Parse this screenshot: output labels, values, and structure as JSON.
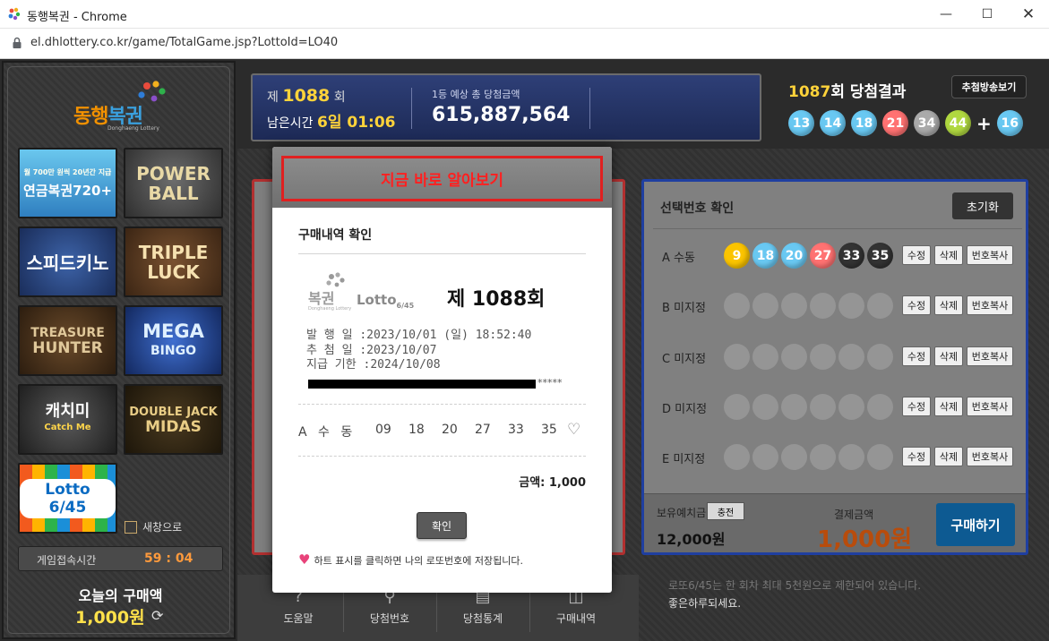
{
  "window": {
    "title": "동행복권 - Chrome",
    "url": "el.dhlottery.co.kr/game/TotalGame.jsp?LottoId=LO40"
  },
  "sidebar": {
    "logo_text_a": "동행",
    "logo_text_b": "복권",
    "logo_sub": "Donghaeng Lottery",
    "games": {
      "pension_badge": "월 700만 원씩 20년간 지급",
      "pension": "연금복권720+",
      "power_1": "POWER",
      "power_2": "BALL",
      "speed": "스피드키노",
      "triple_1": "TRIPLE",
      "triple_2": "LUCK",
      "treasure_1": "TREASURE",
      "treasure_2": "HUNTER",
      "mega_1": "MEGA",
      "mega_2": "BINGO",
      "catch_1": "캐치미",
      "catch_2": "Catch Me",
      "double_1": "DOUBLE JACK",
      "double_2": "MIDAS",
      "lotto": "Lotto 6/45"
    },
    "new_window_label": "새창으로",
    "access_time_label": "게임접속시간",
    "access_time_value": "59 : 04",
    "today_label": "오늘의 구매액",
    "today_amount": "1,000원"
  },
  "top": {
    "round_prefix": "제",
    "round_num": "1088",
    "round_suffix": "회",
    "remain_label": "남은시간",
    "remain_value": "6일 01:06",
    "jackpot_label": "1등 예상 총 당첨금액",
    "jackpot_value": "615,887,564",
    "result_round": "1087",
    "result_suffix": "회 당첨결과",
    "draw_broadcast": "추첨방송보기",
    "win_numbers": [
      "13",
      "14",
      "18",
      "21",
      "34",
      "44"
    ],
    "bonus": "16"
  },
  "selected": {
    "title": "선택번호 확인",
    "reset": "초기화",
    "rows": [
      {
        "label": "A 수동",
        "numbers": [
          "9",
          "18",
          "20",
          "27",
          "33",
          "35"
        ]
      },
      {
        "label": "B 미지정",
        "numbers": []
      },
      {
        "label": "C 미지정",
        "numbers": []
      },
      {
        "label": "D 미지정",
        "numbers": []
      },
      {
        "label": "E 미지정",
        "numbers": []
      }
    ],
    "edit": "수정",
    "delete": "삭제",
    "copy": "번호복사",
    "hold_label": "보유예치금",
    "charge": "충전",
    "hold_value": "12,000원",
    "pay_label": "결제금액",
    "pay_value": "1,000원",
    "buy": "구매하기"
  },
  "bottom_nav": [
    "도움말",
    "당첨번호",
    "당첨통계",
    "구매내역"
  ],
  "notice": {
    "line1": "로또6/45는 한 회차 최대 5천원으로 제한되어 있습니다.",
    "line2": "좋은하루되세요."
  },
  "modal": {
    "banner": "지금 바로 알아보기",
    "title": "구매내역 확인",
    "brand_a": "복권",
    "brand_sub": "Donghaeng Lottery",
    "brand_b": "Lotto",
    "brand_b_sub": "6/45",
    "ticket_round": "제 1088회",
    "issue_date": "발 행 일 :2023/10/01 (일) 18:52:40",
    "draw_date": "추 첨 일 :2023/10/07",
    "pay_deadline": "지급 기한 :2024/10/08",
    "masked": "*****",
    "pick_label": "A 수 동",
    "picks": [
      "09",
      "18",
      "20",
      "27",
      "33",
      "35"
    ],
    "amount": "금액: 1,000",
    "confirm": "확인",
    "hint": "하트 표시를 클릭하면 나의 로또번호에 저장됩니다."
  },
  "colors": {
    "ball_yellow": "#fbc400",
    "ball_blue": "#69c8f2",
    "ball_red": "#ff7272",
    "ball_gray": "#aaaaaa",
    "ball_green": "#b0d840",
    "banner_red": "#ff2020",
    "buy_blue": "#0d5a92"
  }
}
